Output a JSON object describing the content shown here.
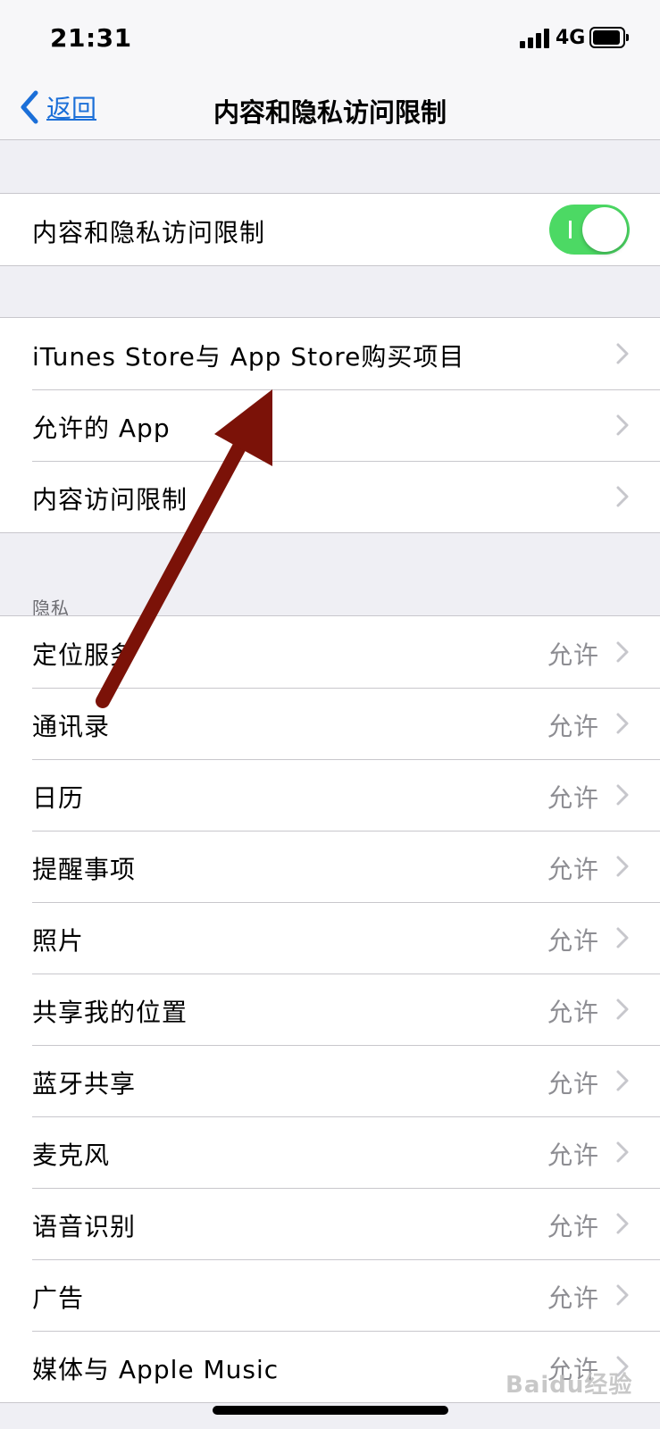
{
  "status_bar": {
    "time": "21:31",
    "network": "4G"
  },
  "nav": {
    "back_label": "返回",
    "title": "内容和隐私访问限制"
  },
  "master": {
    "label": "内容和隐私访问限制",
    "toggle_on": true
  },
  "group1": [
    {
      "label": "iTunes Store与 App Store购买项目"
    },
    {
      "label": "允许的 App"
    },
    {
      "label": "内容访问限制"
    }
  ],
  "privacy": {
    "header": "隐私",
    "items": [
      {
        "label": "定位服务",
        "value": "允许"
      },
      {
        "label": "通讯录",
        "value": "允许"
      },
      {
        "label": "日历",
        "value": "允许"
      },
      {
        "label": "提醒事项",
        "value": "允许"
      },
      {
        "label": "照片",
        "value": "允许"
      },
      {
        "label": "共享我的位置",
        "value": "允许"
      },
      {
        "label": "蓝牙共享",
        "value": "允许"
      },
      {
        "label": "麦克风",
        "value": "允许"
      },
      {
        "label": "语音识别",
        "value": "允许"
      },
      {
        "label": "广告",
        "value": "允许"
      },
      {
        "label": "媒体与 Apple Music",
        "value": "允许"
      }
    ]
  },
  "watermark": "Baidu经验",
  "colors": {
    "accent": "#1b6fd8",
    "toggle": "#4cd964",
    "annotation_arrow": "#7b1208"
  }
}
